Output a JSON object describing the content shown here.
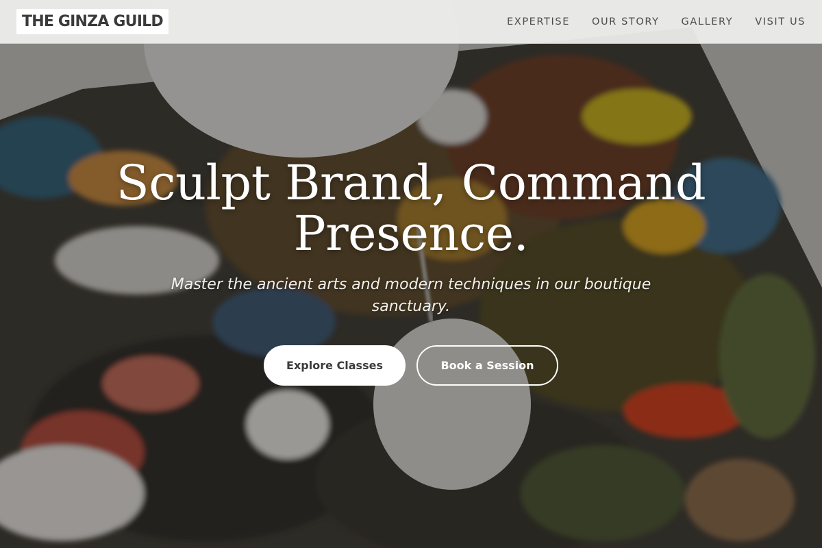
{
  "header": {
    "logo_text": "THE GINZA GUILD",
    "nav": [
      {
        "label": "EXPERTISE"
      },
      {
        "label": "OUR STORY"
      },
      {
        "label": "GALLERY"
      },
      {
        "label": "VISIT US"
      }
    ]
  },
  "hero": {
    "title": "Sculpt Brand, Command Presence.",
    "subtitle": "Master the ancient arts and modern techniques in our boutique sanctuary.",
    "primary_button": "Explore Classes",
    "secondary_button": "Book a Session",
    "background": "paint-palette-photo"
  },
  "colors": {
    "header_bg": "#eeeeec",
    "nav_text": "#4a4a4a",
    "logo_text": "#3a3a3a",
    "button_primary_bg": "#ffffff",
    "button_text_dark": "#3b3b3b",
    "hero_text": "#ffffff"
  }
}
